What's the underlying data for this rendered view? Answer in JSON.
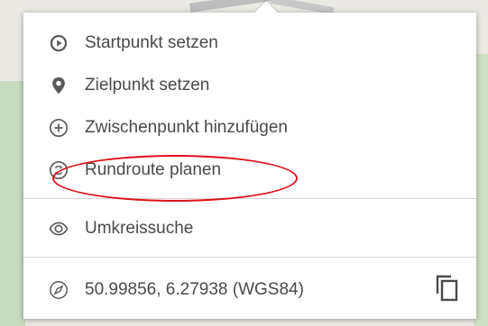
{
  "menu": {
    "items": [
      {
        "label": "Startpunkt setzen",
        "icon": "play-circle-icon"
      },
      {
        "label": "Zielpunkt setzen",
        "icon": "map-pin-icon"
      },
      {
        "label": "Zwischenpunkt hinzufügen",
        "icon": "plus-circle-icon"
      },
      {
        "label": "Rundroute planen",
        "icon": "roundtrip-icon"
      }
    ],
    "search": {
      "label": "Umkreissuche",
      "icon": "eye-icon"
    },
    "coordinates": {
      "label": "50.99856, 6.27938 (WGS84)",
      "icon": "compass-icon",
      "copy_icon": "copy-icon"
    }
  },
  "colors": {
    "text": "#4a4a4a",
    "icon": "#5a5a5a",
    "highlight": "#e0101a",
    "divider": "#d6d6d6"
  }
}
